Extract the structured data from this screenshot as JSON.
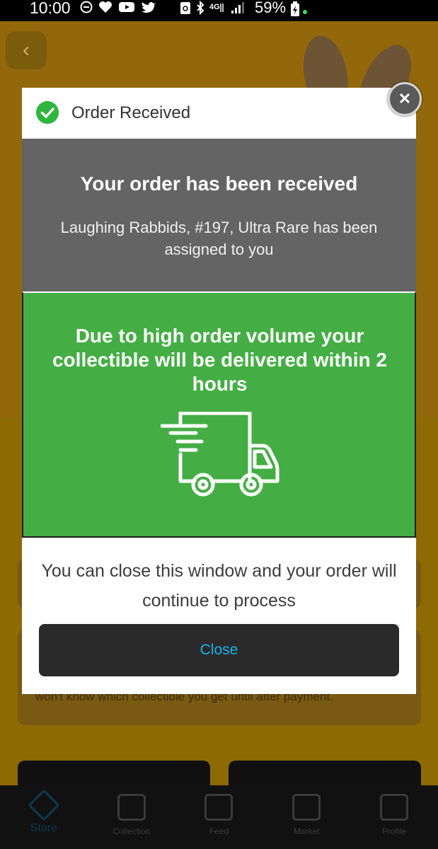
{
  "status_bar": {
    "time": "10:00",
    "battery": "59%"
  },
  "modal": {
    "header_title": "Order Received",
    "headline": "Your order has been received",
    "description": "Laughing Rabbids, #197, Ultra Rare has been assigned to you",
    "delivery_notice": "Due to high order volume your collectible will be delivered within 2 hours",
    "close_info": "You can close this window and your order will continue to process",
    "close_button_label": "Close"
  },
  "background": {
    "partial_text": "won't know which collectible you get until after payment."
  },
  "bottom_nav": {
    "items": [
      {
        "label": "Store",
        "icon": "tag-icon"
      },
      {
        "label": "Collection",
        "icon": "box-icon"
      },
      {
        "label": "Feed",
        "icon": "feed-icon"
      },
      {
        "label": "Market",
        "icon": "storefront-icon"
      },
      {
        "label": "Profile",
        "icon": "profile-icon"
      }
    ]
  },
  "colors": {
    "success_green": "#44ae44",
    "header_gray": "#646464",
    "close_accent": "#1fb1ea"
  }
}
